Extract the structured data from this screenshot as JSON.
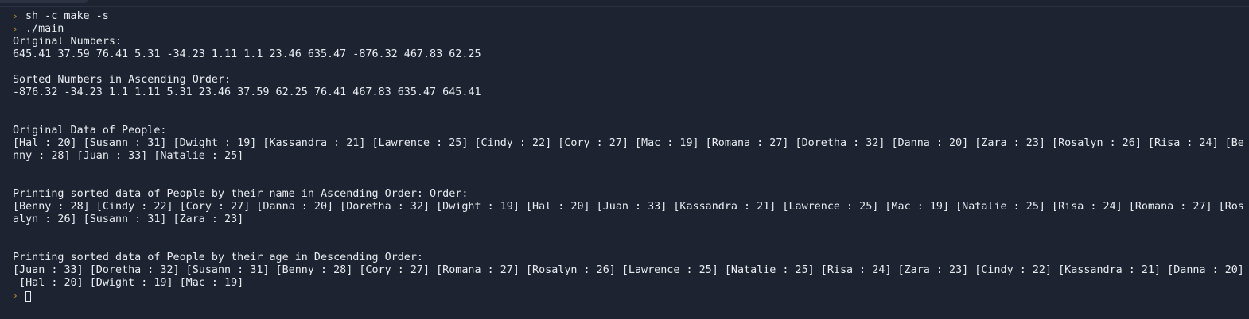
{
  "terminal": {
    "prompt_symbol": "›",
    "commands": {
      "make": "sh -c make -s",
      "run": "./main"
    },
    "output": {
      "original_numbers_label": "Original Numbers:",
      "original_numbers": "645.41 37.59 76.41 5.31 -34.23 1.11 1.1 23.46 635.47 -876.32 467.83 62.25",
      "sorted_numbers_label": "Sorted Numbers in Ascending Order:",
      "sorted_numbers": "-876.32 -34.23 1.1 1.11 5.31 23.46 37.59 62.25 76.41 467.83 635.47 645.41",
      "original_people_label": "Original Data of People:",
      "original_people_line1": "[Hal : 20] [Susann : 31] [Dwight : 19] [Kassandra : 21] [Lawrence : 25] [Cindy : 22] [Cory : 27] [Mac : 19] [Romana : 27] [Doretha : 32] [Danna : 20] [Zara : 23] [Rosalyn : 26] [Risa : 24] [Be",
      "original_people_line2": "nny : 28] [Juan : 33] [Natalie : 25]",
      "by_name_label": "Printing sorted data of People by their name in Ascending Order: Order:",
      "by_name_line1": "[Benny : 28] [Cindy : 22] [Cory : 27] [Danna : 20] [Doretha : 32] [Dwight : 19] [Hal : 20] [Juan : 33] [Kassandra : 21] [Lawrence : 25] [Mac : 19] [Natalie : 25] [Risa : 24] [Romana : 27] [Ros",
      "by_name_line2": "alyn : 26] [Susann : 31] [Zara : 23]",
      "by_age_label": "Printing sorted data of People by their age in Descending Order:",
      "by_age_line1": "[Juan : 33] [Doretha : 32] [Susann : 31] [Benny : 28] [Cory : 27] [Romana : 27] [Rosalyn : 26] [Lawrence : 25] [Natalie : 25] [Risa : 24] [Zara : 23] [Cindy : 22] [Kassandra : 21] [Danna : 20]",
      "by_age_line2": " [Hal : 20] [Dwight : 19] [Mac : 19]"
    },
    "colors": {
      "background": "#1d2331",
      "text": "#e8ebf0",
      "prompt": "#c9a227"
    }
  }
}
